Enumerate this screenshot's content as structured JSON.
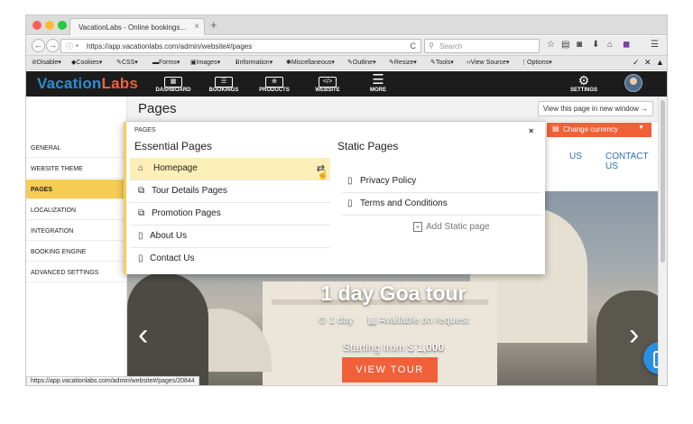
{
  "browser": {
    "tab_title": "VacationLabs - Online bookings...",
    "tab_close": "×",
    "new_tab": "+",
    "url": "https://app.vacationlabs.com/admin/website#/pages",
    "search_placeholder": "Search",
    "status_url": "https://app.vacationlabs.com/admin/website#/pages/20844",
    "dots": {
      "red": "#fc5f57",
      "yellow": "#fdbc2e",
      "green": "#28c840"
    }
  },
  "devbar": {
    "items": [
      "Disable",
      "Cookies",
      "CSS",
      "Forms",
      "Images",
      "Information",
      "Miscellaneous",
      "Outline",
      "Resize",
      "Tools",
      "View Source",
      "Options"
    ]
  },
  "app": {
    "logo_part1": "Vacation",
    "logo_part2": "Labs",
    "nav": [
      "DASHBOARD",
      "BOOKINGS",
      "PRODUCTS",
      "WEBSITE",
      "MORE"
    ],
    "settings_label": "SETTINGS",
    "website_icon_text": "</>"
  },
  "page": {
    "title": "Pages",
    "view_button": "View this page in new window →"
  },
  "sidebar": {
    "items": [
      "GENERAL",
      "WEBSITE THEME",
      "PAGES",
      "LOCALIZATION",
      "INTEGRATION",
      "BOOKING ENGINE",
      "ADVANCED SETTINGS"
    ],
    "active_index": 2
  },
  "menu": {
    "eyebrow": "PAGES",
    "close": "×",
    "essential_heading": "Essential Pages",
    "static_heading": "Static Pages",
    "essential": [
      "Homepage",
      "Tour Details Pages",
      "Promotion Pages",
      "About Us",
      "Contact Us"
    ],
    "static": [
      "Privacy Policy",
      "Terms and Conditions"
    ],
    "add_static": "Add Static page"
  },
  "preview": {
    "currency": "Change currency",
    "nav_us": "US",
    "nav_contact": "CONTACT US",
    "tour_title": "1 day Goa tour",
    "duration": "1 day",
    "availability": "Available on request",
    "price_prefix": "Starting from",
    "price": "$ 1,000",
    "cta": "VIEW TOUR",
    "arrow_left": "‹",
    "arrow_right": "›"
  }
}
